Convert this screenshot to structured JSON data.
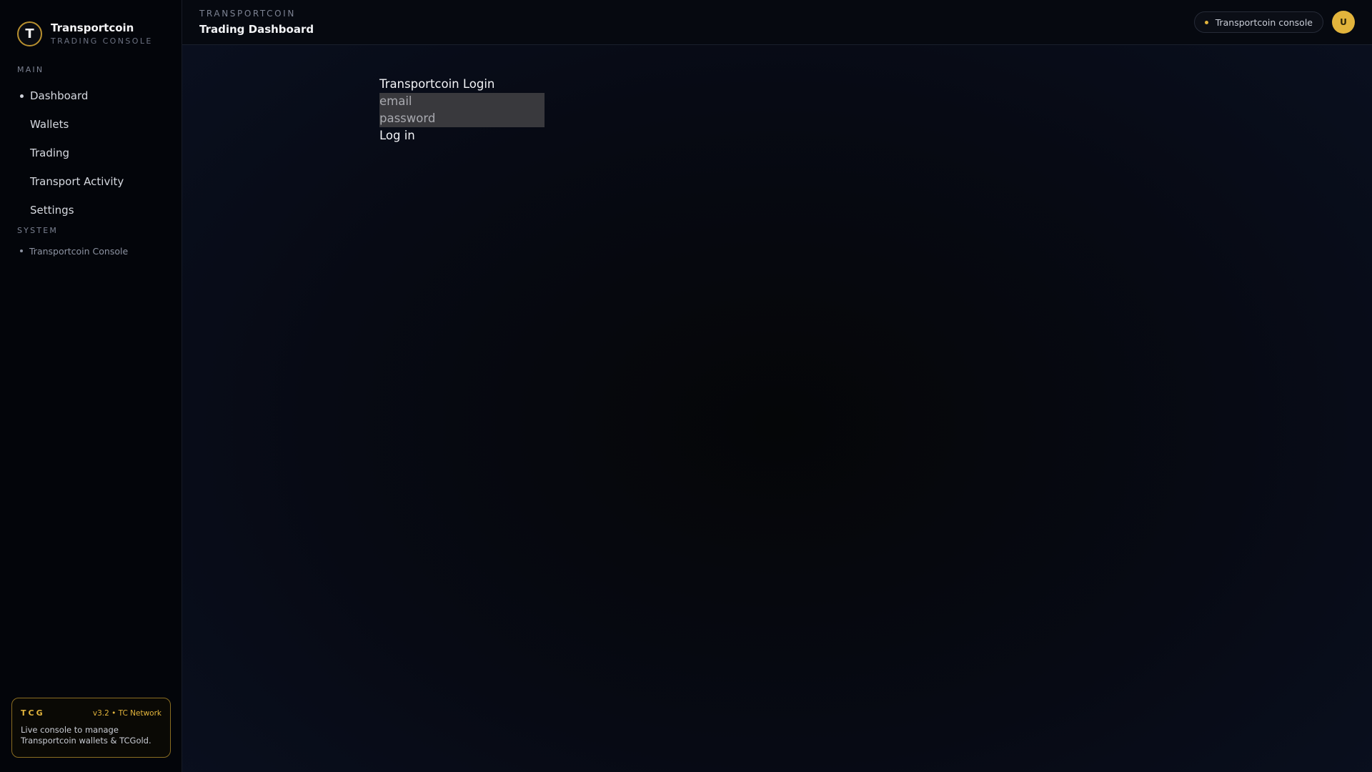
{
  "brand": {
    "logo_letter": "T",
    "name": "Transportcoin",
    "subtitle": "TRADING CONSOLE"
  },
  "sidebar": {
    "main_label": "MAIN",
    "items": [
      {
        "label": "Dashboard",
        "active": true
      },
      {
        "label": "Wallets",
        "active": false
      },
      {
        "label": "Trading",
        "active": false
      },
      {
        "label": "Transport Activity",
        "active": false
      },
      {
        "label": "Settings",
        "active": false
      }
    ],
    "system_label": "SYSTEM",
    "system_items": [
      {
        "label": "Transportcoin Console"
      }
    ],
    "footer": {
      "tag": "TCG",
      "version": "v3.2 • TC Network",
      "description": "Live console to manage Transportcoin wallets & TCGold."
    }
  },
  "header": {
    "eyebrow": "TRANSPORTCOIN",
    "title": "Trading Dashboard",
    "console_pill": "Transportcoin console",
    "avatar_initial": "U"
  },
  "login": {
    "title": "Transportcoin Login",
    "email_placeholder": "email",
    "password_placeholder": "password",
    "submit_label": "Log in"
  },
  "colors": {
    "accent_gold": "#e2b43c",
    "background": "#05070d",
    "input_background": "#39393d"
  }
}
